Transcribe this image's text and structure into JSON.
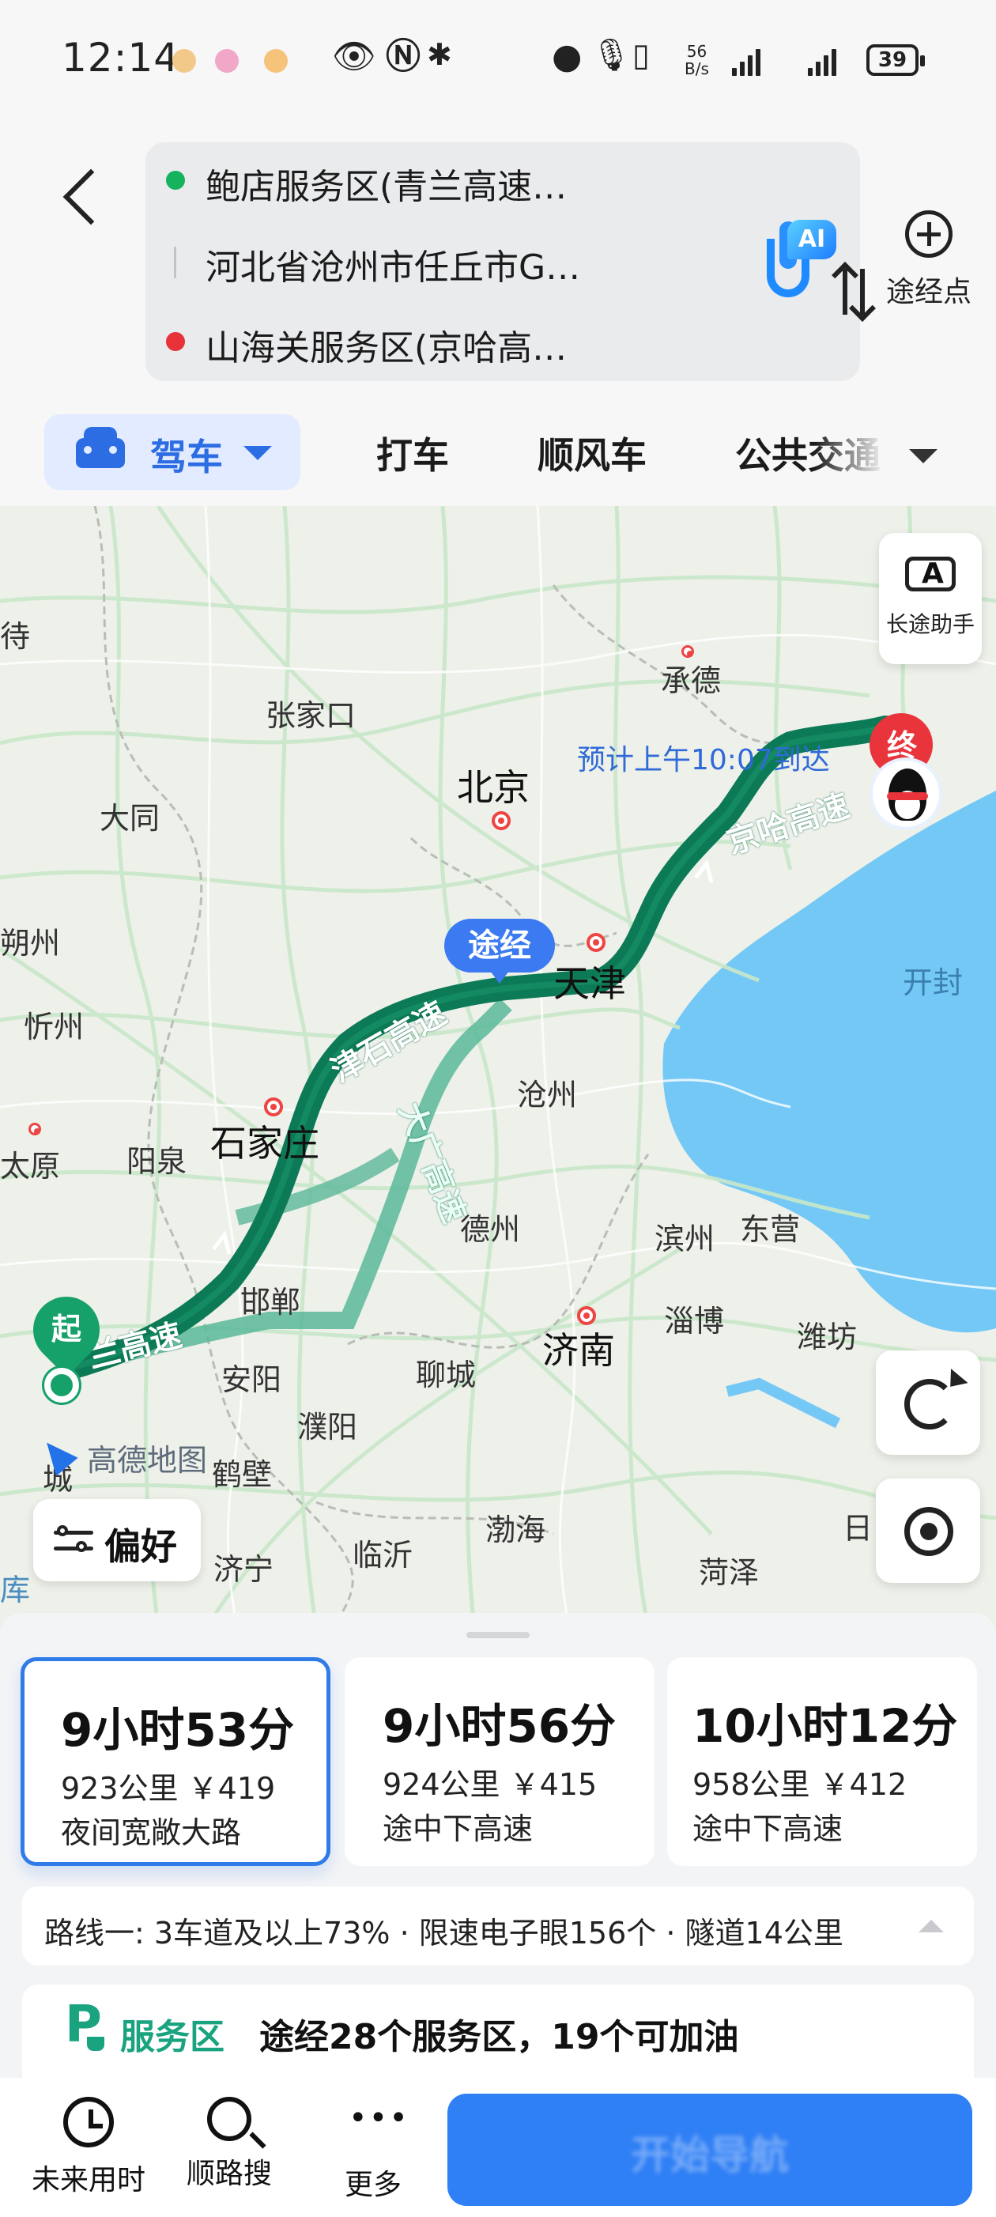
{
  "status_bar": {
    "time": "12:14",
    "net_speed_value": "56",
    "net_speed_unit": "B/s",
    "battery": "39",
    "icons": [
      "eye-icon",
      "nfc-icon",
      "bluetooth-icon",
      "location-icon",
      "mic-icon",
      "vibrate-icon",
      "signal-icon",
      "battery-icon"
    ]
  },
  "header": {
    "origin": "鲍店服务区(青兰高速…",
    "waypoint": "河北省沧州市任丘市G…",
    "destination": "山海关服务区(京哈高…",
    "add_waypoint_label": "途经点",
    "ai_badge": "AI"
  },
  "mode_tabs": {
    "drive": "驾车",
    "taxi": "打车",
    "carpool": "顺风车",
    "transit": "公共交通"
  },
  "map": {
    "long_trip_assistant": "长途助手",
    "eta": "预计上午10:07到达",
    "via_pill": "途经",
    "end_marker": "终",
    "start_marker": "起",
    "logo": "高德地图",
    "preference": "偏好",
    "road_labels": [
      "京哈高速",
      "津石高速",
      "大广高速",
      "兰高速"
    ],
    "cities": [
      "北京",
      "天津",
      "石家庄",
      "济南",
      "承德",
      "张家口",
      "大同",
      "沧州",
      "德州",
      "邯郸",
      "安阳",
      "聊城",
      "淄博",
      "潍坊",
      "滨州",
      "东营",
      "太原",
      "阳泉",
      "忻州",
      "朔州",
      "濮阳",
      "鹤壁",
      "开封",
      "菏泽",
      "济宁",
      "临沂",
      "渤海",
      "待",
      "日",
      "城",
      "库"
    ]
  },
  "routes": [
    {
      "time": "9小时53分",
      "meta": "923公里 ￥419",
      "tag": "夜间宽敞大路"
    },
    {
      "time": "9小时56分",
      "meta": "924公里 ￥415",
      "tag": "途中下高速"
    },
    {
      "time": "10小时12分",
      "meta": "958公里 ￥412",
      "tag": "途中下高速"
    }
  ],
  "summary": "路线一:  3车道及以上73% · 限速电子眼156个 · 隧道14公里",
  "service_area": {
    "label": "服务区",
    "text": "途经28个服务区，19个可加油"
  },
  "bottom_bar": {
    "future_time": "未来用时",
    "along_search": "顺路搜",
    "more": "更多",
    "start_navigation": "开始导航"
  },
  "colors": {
    "accent_blue": "#2f7be8",
    "route_green": "#0d7a57",
    "alt_route_green": "#5bb89a",
    "start_green": "#16a16a",
    "end_red": "#e8343a",
    "sea_blue": "#74c8f5"
  }
}
